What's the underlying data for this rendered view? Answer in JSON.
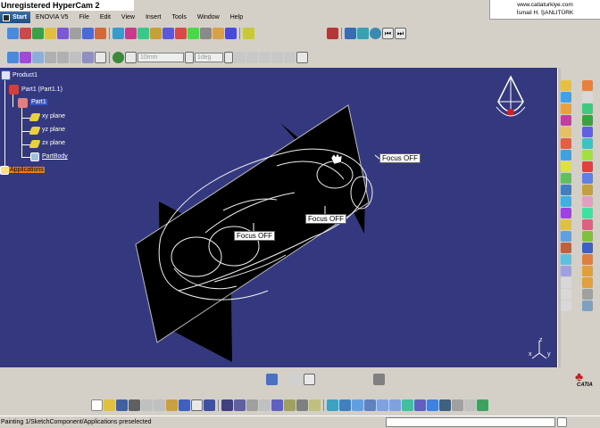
{
  "watermark": "Unregistered HyperCam 2",
  "credit": {
    "line1": "www.catiaturkiye.com",
    "line2": "İsmail H. ŞANLITÜRK"
  },
  "menubar": {
    "start": "Start",
    "items": [
      "ENOVIA V5",
      "File",
      "Edit",
      "View",
      "Insert",
      "Tools",
      "Window",
      "Help"
    ]
  },
  "toolbar2": {
    "length_field": "10mm",
    "angle_field": "1deg"
  },
  "tree": {
    "root": "Product1",
    "part_instance": "Part1 (Part1.1)",
    "part": "Part1",
    "planes": [
      "xy plane",
      "yz plane",
      "zx plane"
    ],
    "body": "PartBody",
    "applications": "Applications"
  },
  "viewport": {
    "callouts": [
      "Focus OFF",
      "Focus OFF",
      "Focus OFF"
    ],
    "axis_label_x": "x",
    "axis_label_y": "y",
    "axis_label_z": "z",
    "background": "#34387e"
  },
  "brand": "CATIA",
  "status": {
    "text": "Painting 1/SketchComponent/Applications preselected"
  }
}
